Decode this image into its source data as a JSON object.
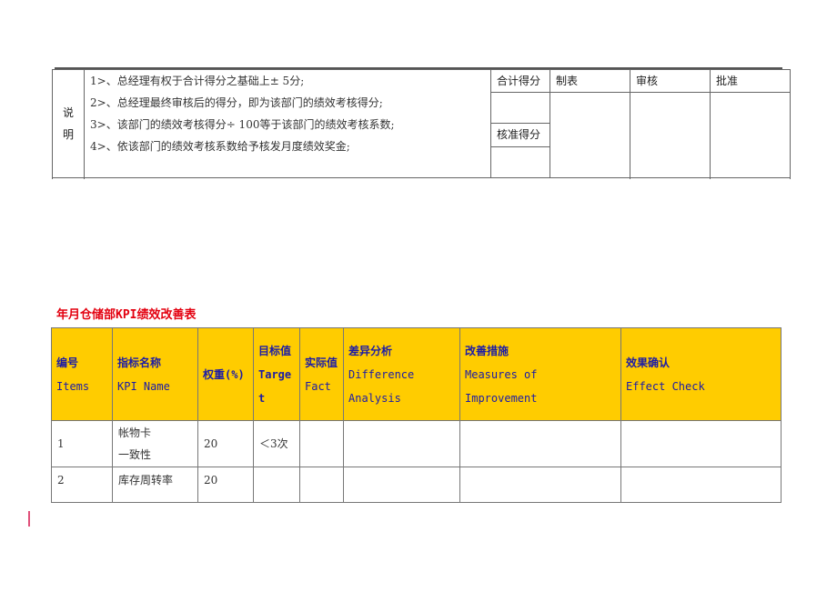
{
  "notes_table": {
    "label": "说 明",
    "label_lines": [
      "说",
      "明"
    ],
    "notes": [
      "1>、总经理有权于合计得分之基础上± 5分;",
      "2>、总经理最终审核后的得分，即为该部门的绩效考核得分;",
      "3>、该部门的绩效考核得分÷ 100等于该部门的绩效考核系数;",
      "4>、依该部门的绩效考核系数给予核发月度绩效奖金;"
    ],
    "total_score_label": "合计得分",
    "total_score_value": "",
    "approved_score_label": "核准得分",
    "approved_score_value": "",
    "prepared_by_label": "制表",
    "reviewed_by_label": "审核",
    "approved_by_label": "批准"
  },
  "improvement_table": {
    "title": "年月仓储部KPI绩效改善表",
    "headers": [
      {
        "cn": "编号",
        "en": "Items"
      },
      {
        "cn": "指标名称",
        "en": "KPI Name"
      },
      {
        "cn": "权重(%)",
        "en": ""
      },
      {
        "cn": "目标值",
        "en": "Target"
      },
      {
        "cn": "实际值",
        "en": "Fact"
      },
      {
        "cn": "差异分析",
        "en": "Difference Analysis"
      },
      {
        "cn": "改善措施",
        "en": "Measures of Improvement"
      },
      {
        "cn": "效果确认",
        "en": "Effect Check"
      }
    ],
    "rows": [
      {
        "item": "1",
        "kpi_name": "帐物卡一致性",
        "kpi_name_lines": [
          "帐物卡",
          "一致性"
        ],
        "weight": "20",
        "target": "＜3次",
        "fact": "",
        "difference": "",
        "measures": "",
        "effect": ""
      },
      {
        "item": "2",
        "kpi_name": "库存周转率",
        "weight": "20",
        "target": "",
        "fact": "",
        "difference": "",
        "measures": "",
        "effect": ""
      }
    ]
  },
  "colors": {
    "header_bg": "#ffcc00",
    "header_text": "#1c1ca6",
    "title_text": "#e3000f"
  }
}
